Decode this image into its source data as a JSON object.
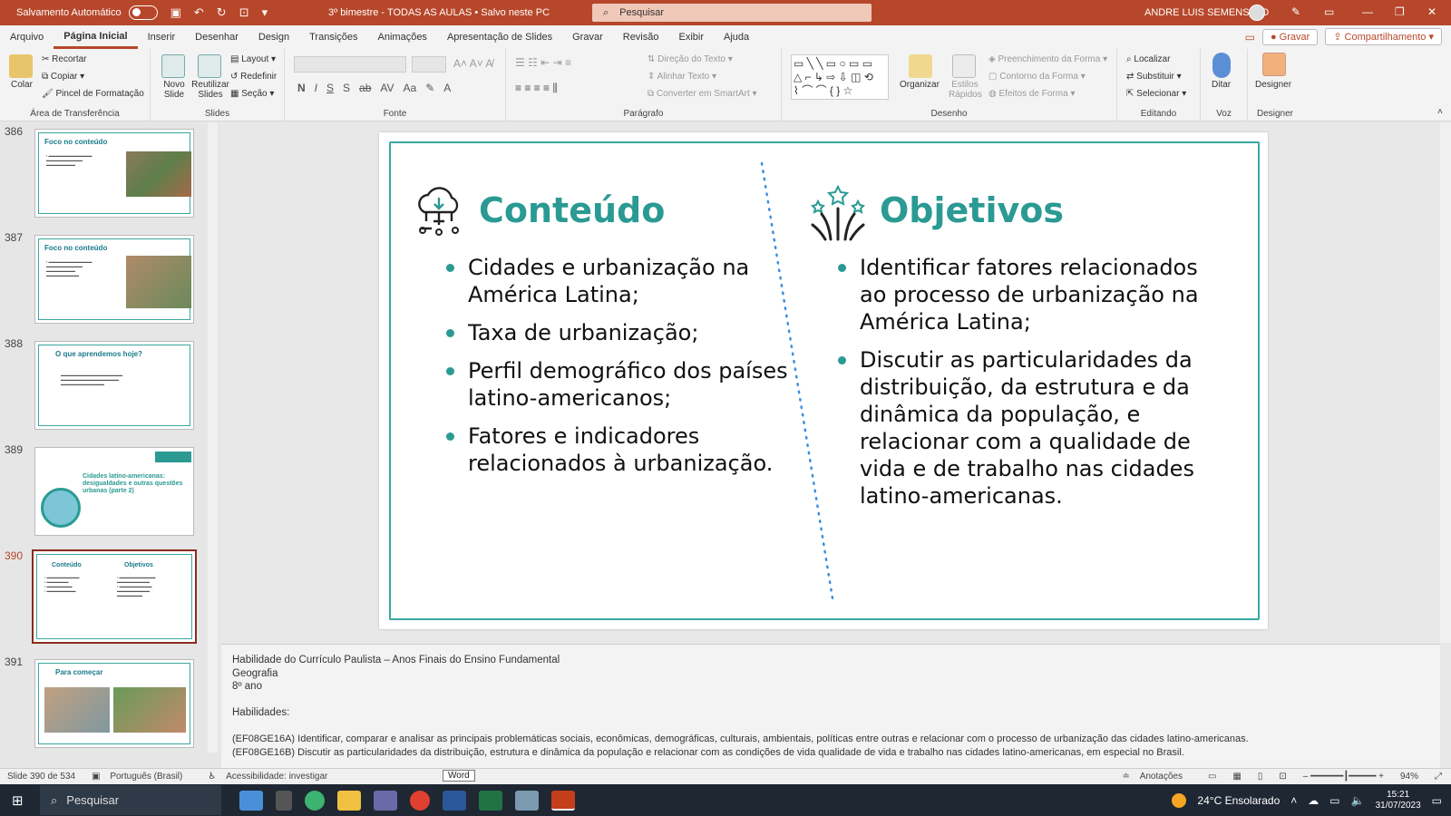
{
  "titlebar": {
    "autosave": "Salvamento Automático",
    "doc_title": "3º bimestre - TODAS AS AULAS • Salvo neste PC",
    "search_placeholder": "Pesquisar",
    "user": "ANDRE LUIS SEMENSATO"
  },
  "tabs": [
    "Arquivo",
    "Página Inicial",
    "Inserir",
    "Desenhar",
    "Design",
    "Transições",
    "Animações",
    "Apresentação de Slides",
    "Gravar",
    "Revisão",
    "Exibir",
    "Ajuda"
  ],
  "tabs_right": {
    "record": "Gravar",
    "share": "Compartilhamento"
  },
  "ribbon": {
    "clipboard": {
      "paste": "Colar",
      "cut": "Recortar",
      "copy": "Copiar",
      "painter": "Pincel de Formatação",
      "label": "Área de Transferência"
    },
    "slides": {
      "new": "Novo Slide",
      "reuse": "Reutilizar Slides",
      "layout": "Layout",
      "reset": "Redefinir",
      "section": "Seção",
      "label": "Slides"
    },
    "font": {
      "label": "Fonte"
    },
    "paragraph": {
      "text_dir": "Direção do Texto",
      "align_text": "Alinhar Texto",
      "smartart": "Converter em SmartArt",
      "label": "Parágrafo"
    },
    "drawing": {
      "arrange": "Organizar",
      "quick_styles": "Estilos Rápidos",
      "fill": "Preenchimento da Forma",
      "outline": "Contorno da Forma",
      "effects": "Efeitos de Forma",
      "label": "Desenho"
    },
    "editing": {
      "find": "Localizar",
      "replace": "Substituir",
      "select": "Selecionar",
      "label": "Editando"
    },
    "voice": {
      "dictate": "Ditar",
      "label": "Voz"
    },
    "designer": {
      "btn": "Designer",
      "label": "Designer"
    }
  },
  "thumbnails": [
    {
      "num": "386",
      "title": "Foco no conteúdo"
    },
    {
      "num": "387",
      "title": "Foco no conteúdo"
    },
    {
      "num": "388",
      "title": "O que aprendemos hoje?"
    },
    {
      "num": "389",
      "title": "Cidades latino-americanas: desigualdades e outras questões urbanas (parte 2)"
    },
    {
      "num": "390",
      "title": "Conteúdo"
    },
    {
      "num": "391",
      "title": "Para começar"
    }
  ],
  "slide": {
    "left_heading": "Conteúdo",
    "left_items": [
      "Cidades e urbanização na América Latina;",
      "Taxa de urbanização;",
      "Perfil demográfico dos países latino-americanos;",
      "Fatores e indicadores relacionados à urbanização."
    ],
    "right_heading": "Objetivos",
    "right_items": [
      "Identificar fatores relacionados ao processo de urbanização na América Latina;",
      "Discutir as particularidades da distribuição, da estrutura e da dinâmica da população, e relacionar com a qualidade de vida e de trabalho nas cidades latino-americanas."
    ]
  },
  "notes": [
    "Habilidade do Currículo Paulista – Anos Finais do Ensino Fundamental",
    "Geografia",
    "8º ano",
    "",
    "Habilidades:",
    "",
    "(EF08GE16A) Identificar, comparar e analisar as principais problemáticas sociais, econômicas, demográficas, culturais, ambientais, políticas entre outras e relacionar com o processo de urbanização das cidades latino-americanas.",
    "(EF08GE16B) Discutir as particularidades da distribuição, estrutura e dinâmica da população e relacionar com as condições de vida qualidade de vida e trabalho nas cidades latino-americanas, em especial no Brasil."
  ],
  "status": {
    "slide_count": "Slide 390 de 534",
    "language": "Português (Brasil)",
    "accessibility": "Acessibilidade: investigar",
    "tooltip": "Word",
    "notes_btn": "Anotações",
    "zoom": "94%"
  },
  "taskbar": {
    "search": "Pesquisar",
    "weather": "24°C  Ensolarado",
    "time": "15:21",
    "date": "31/07/2023"
  }
}
